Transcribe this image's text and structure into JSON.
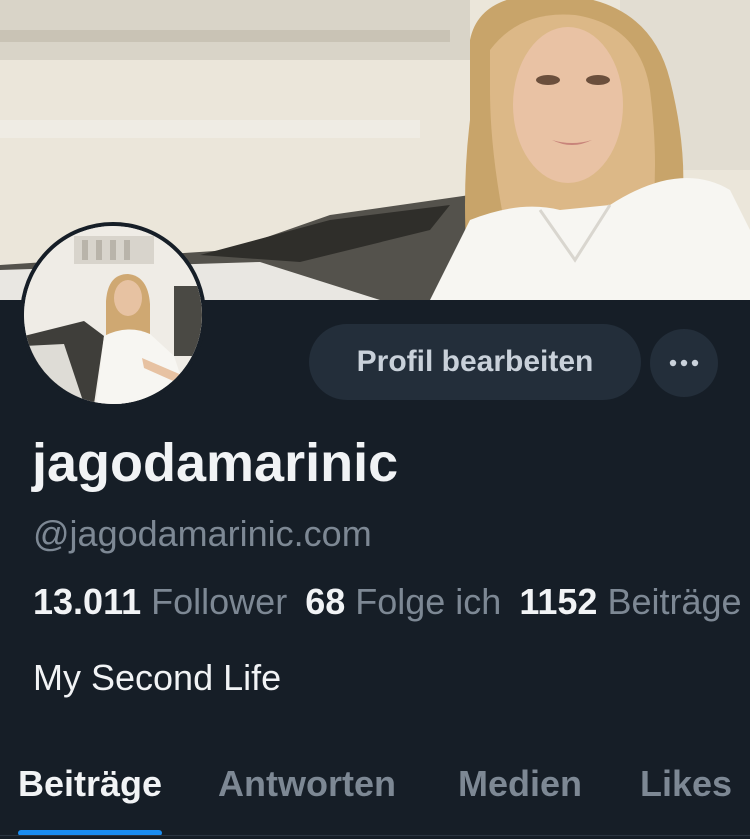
{
  "profile": {
    "display_name": "jagodamarinic",
    "handle": "@jagodamarinic.com",
    "bio": "My Second Life"
  },
  "actions": {
    "edit_profile_label": "Profil bearbeiten",
    "more_label": "···"
  },
  "stats": [
    {
      "value": "13.011",
      "label": "Follower"
    },
    {
      "value": "68",
      "label": "Folge ich"
    },
    {
      "value": "1152",
      "label": "Beiträge"
    }
  ],
  "tabs": [
    {
      "label": "Beiträge",
      "active": true
    },
    {
      "label": "Antworten",
      "active": false
    },
    {
      "label": "Medien",
      "active": false
    },
    {
      "label": "Likes",
      "active": false
    }
  ],
  "colors": {
    "background": "#161e27",
    "accent": "#1a8cf0",
    "muted_text": "#7d8894",
    "button_bg": "#232e3a"
  },
  "icons": {
    "more": "ellipsis-icon"
  }
}
